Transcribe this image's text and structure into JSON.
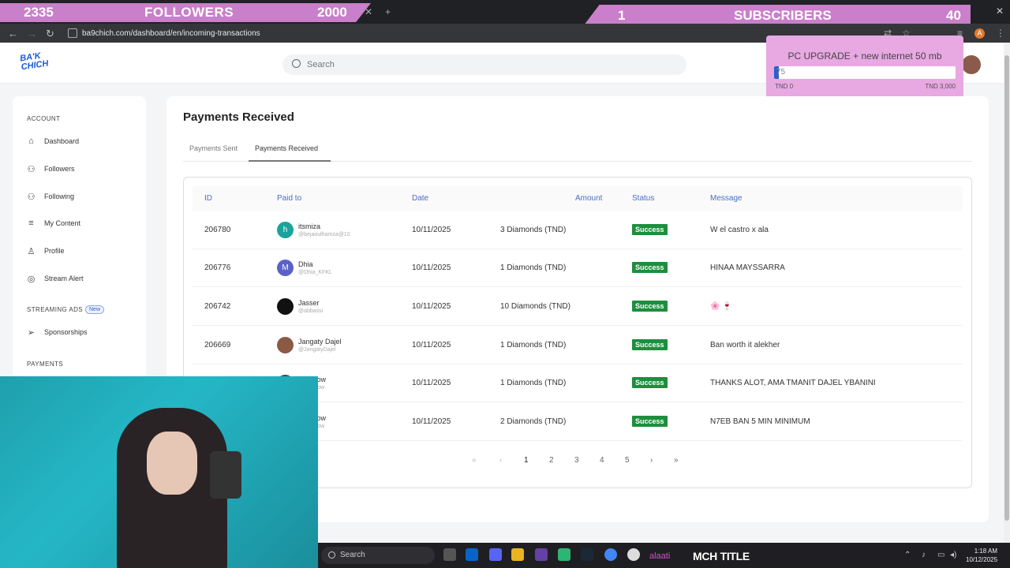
{
  "overlays": {
    "followers": {
      "current": "2335",
      "label": "FOLLOWERS",
      "goal": "2000"
    },
    "subscribers": {
      "current": "1",
      "label": "SUBSCRIBERS",
      "goal": "40"
    },
    "goal_widget": {
      "title": "PC UPGRADE + new internet 50 mb",
      "value": "75",
      "progress_fraction": 0.025,
      "min_label": "TND 0",
      "max_label": "TND 3,000"
    }
  },
  "browser": {
    "url": "ba9chich.com/dashboard/en/incoming-transactions",
    "profile_initial": "A"
  },
  "app": {
    "logo_line1": "BA'K",
    "logo_line2": "CHICH",
    "search_placeholder": "Search"
  },
  "sidebar": {
    "sections": [
      {
        "title": "ACCOUNT",
        "items": [
          {
            "label": "Dashboard",
            "icon": "home-icon"
          },
          {
            "label": "Followers",
            "icon": "users-icon"
          },
          {
            "label": "Following",
            "icon": "users-icon"
          },
          {
            "label": "My Content",
            "icon": "list-icon"
          },
          {
            "label": "Profile",
            "icon": "user-icon"
          },
          {
            "label": "Stream Alert",
            "icon": "radio-icon"
          }
        ]
      },
      {
        "title": "STREAMING ADS",
        "badge": "New",
        "items": [
          {
            "label": "Sponsorships",
            "icon": "send-icon"
          }
        ]
      },
      {
        "title": "PAYMENTS",
        "items": []
      }
    ]
  },
  "page": {
    "title": "Payments Received",
    "tabs": [
      "Payments Sent",
      "Payments Received"
    ],
    "active_tab": "Payments Received"
  },
  "table": {
    "columns": [
      "ID",
      "Paid to",
      "Date",
      "Amount",
      "Status",
      "Message"
    ],
    "rows": [
      {
        "id": "206780",
        "name": "itsmiza",
        "handle": "@bejaoulhamza@10",
        "avatar_letter": "h",
        "avatar_color": "#1aa39a",
        "date": "10/11/2025",
        "amount": "3 Diamonds (TND)",
        "status": "Success",
        "message": "W el castro x ala"
      },
      {
        "id": "206776",
        "name": "Dhia",
        "handle": "@Dhia_KFKL",
        "avatar_letter": "M",
        "avatar_color": "#5a62c7",
        "date": "10/11/2025",
        "amount": "1 Diamonds (TND)",
        "status": "Success",
        "message": "HINAA MAYSSARRA"
      },
      {
        "id": "206742",
        "name": "Jasser",
        "handle": "@abbassi",
        "avatar_letter": "",
        "avatar_color": "#111111",
        "date": "10/11/2025",
        "amount": "10 Diamonds (TND)",
        "status": "Success",
        "message": "🌸 🍷"
      },
      {
        "id": "206669",
        "name": "Jangaty Dajel",
        "handle": "@JangatyDajel",
        "avatar_letter": "",
        "avatar_color": "#8a5a45",
        "date": "10/11/2025",
        "amount": "1 Diamonds (TND)",
        "status": "Success",
        "message": "Ban worth it alekher"
      },
      {
        "id": "",
        "name": "tonyNow",
        "handle": "@tonynow",
        "avatar_letter": "",
        "avatar_color": "#444444",
        "date": "10/11/2025",
        "amount": "1 Diamonds (TND)",
        "status": "Success",
        "message": "THANKS ALOT, AMA TMANIT DAJEL YBANINI"
      },
      {
        "id": "",
        "name": "tonyNow",
        "handle": "@tonynow",
        "avatar_letter": "",
        "avatar_color": "#444444",
        "date": "10/11/2025",
        "amount": "2 Diamonds (TND)",
        "status": "Success",
        "message": "N7EB BAN 5 MIN MINIMUM"
      }
    ]
  },
  "pagination": {
    "first": "«",
    "prev": "‹",
    "pages": [
      "1",
      "2",
      "3",
      "4",
      "5"
    ],
    "current": "1",
    "next": "›",
    "last": "»"
  },
  "taskbar": {
    "search": "Search",
    "overlay_text": "MCH TITLE",
    "overlay_pink": "alaati",
    "time": "1:18 AM",
    "date": "10/12/2025"
  },
  "colors": {
    "accent": "#2e5fc9",
    "success": "#1e8e3e",
    "overlay_pink": "#c97fc9"
  }
}
